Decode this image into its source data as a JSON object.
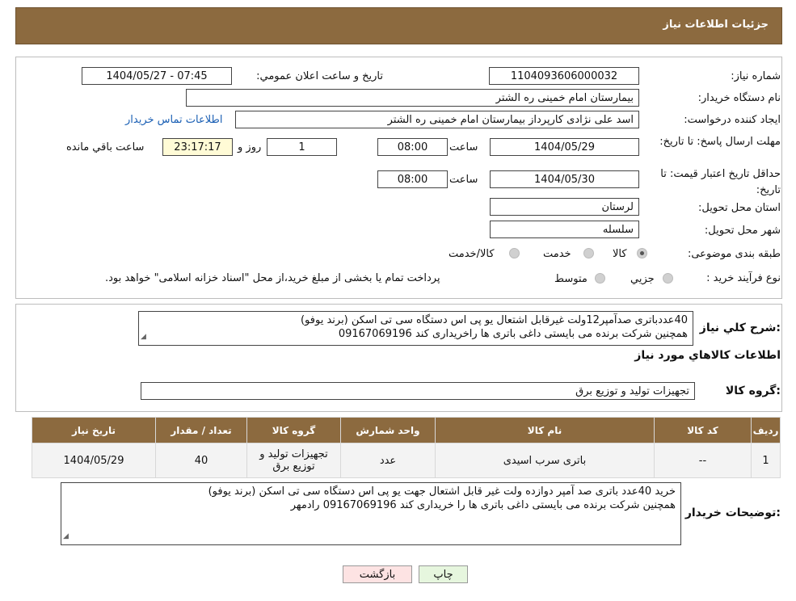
{
  "header": {
    "title": "جزئیات اطلاعات نیاز"
  },
  "form": {
    "need_number_label": "شماره نیاز:",
    "need_number": "1104093606000032",
    "announce_label": "تاریخ و ساعت اعلان عمومي:",
    "announce_value": "1404/05/27 - 07:45",
    "buyer_org_label": "نام دستگاه خریدار:",
    "buyer_org": "بیمارستان امام خمینی ره الشتر",
    "creator_label": "ایجاد کننده درخواست:",
    "creator": "اسد علی نژادی کارپرداز بیمارستان امام خمینی ره الشتر",
    "contact_link": "اطلاعات تماس خریدار",
    "deadline_label": "مهلت ارسال پاسخ: تا تاریخ:",
    "deadline_date": "1404/05/29",
    "time_label": "ساعت",
    "deadline_time": "08:00",
    "days_value": "1",
    "days_label": "روز و",
    "remaining_time": "23:17:17",
    "remaining_label": "ساعت باقي مانده",
    "validity_label": "حداقل تاریخ اعتبار قیمت: تا تاریخ:",
    "validity_date": "1404/05/30",
    "validity_time": "08:00",
    "province_label": "استان محل تحویل:",
    "province": "لرستان",
    "city_label": "شهر محل تحویل:",
    "city": "سلسله",
    "category_label": "طبقه بندی موضوعی:",
    "category_options": [
      "کالا",
      "خدمت",
      "کالا/خدمت"
    ],
    "category_selected": "کالا",
    "process_label": "نوع فرآیند خرید :",
    "process_options": [
      "جزيي",
      "متوسط"
    ],
    "process_note": "پرداخت تمام یا بخشی از مبلغ خرید،از محل \"اسناد خزانه اسلامی\" خواهد بود."
  },
  "description": {
    "label": "شرح کلي نياز:",
    "line1": "40عددباتری صدآمپر12ولت غیرقابل اشتعال یو پی اس دستگاه سی تی اسکن (برند یوفو)",
    "line2": "همچنین شرکت برنده می بایستی داغی باتری ها راخریداری کند  09167069196"
  },
  "goods": {
    "section_title": "اطلاعات کالاهاي مورد نياز",
    "group_label": "گروه کالا:",
    "group_value": "تجهیزات تولید و توزیع برق",
    "columns": [
      "ردیف",
      "کد کالا",
      "نام کالا",
      "واحد شمارش",
      "گروه کالا",
      "تعداد / مقدار",
      "تاریخ نیاز"
    ],
    "rows": [
      [
        "1",
        "--",
        "باتری سرب اسیدی",
        "عدد",
        "تجهیزات تولید و توزیع برق",
        "40",
        "1404/05/29"
      ]
    ]
  },
  "buyer_notes": {
    "label": "توضیحات خریدار:",
    "line1": "خرید 40عدد باتری صد آمپر دوازده ولت غیر قابل اشتعال جهت یو پی اس دستگاه سی تی اسکن (برند یوفو)",
    "line2": "همچنین شرکت برنده می بایستی داغی باتری ها را خریداری کند  09167069196   رادمهر"
  },
  "buttons": {
    "print": "چاپ",
    "back": "بازگشت"
  },
  "colors": {
    "header_bg": "#8c6a3f",
    "yellow_box": "#fffbd6",
    "back_btn_bg": "#fde3e3",
    "print_btn_bg": "#e6f6de",
    "link": "#1a5fb4"
  }
}
